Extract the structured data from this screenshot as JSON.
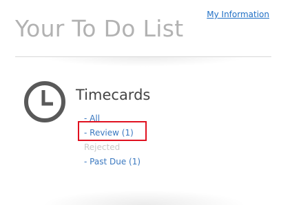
{
  "header": {
    "my_information_link": "My Information",
    "title": "Your To Do List"
  },
  "timecards": {
    "icon": "clock-icon",
    "title": "Timecards",
    "links": [
      {
        "label": "- All",
        "enabled": true
      },
      {
        "label": "- Review (1)",
        "enabled": true,
        "highlighted": true
      },
      {
        "label": "Rejected",
        "enabled": false
      },
      {
        "label": "- Past Due (1)",
        "enabled": true
      }
    ]
  },
  "colors": {
    "link": "#3a78c0",
    "title": "#b2b2b2",
    "disabled": "#c9c9c9",
    "highlight": "#e0101f"
  }
}
